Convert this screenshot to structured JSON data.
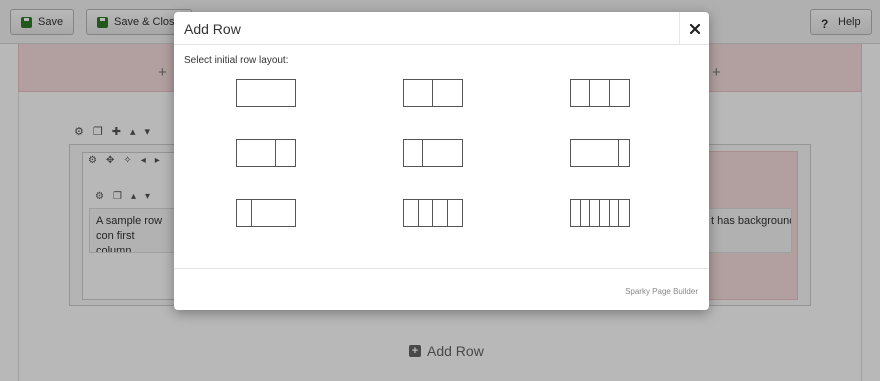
{
  "toolbar": {
    "save_label": "Save",
    "save_close_label": "Save & Close",
    "help_label": "Help"
  },
  "builder": {
    "sample_text_left": "A sample row con first column.",
    "sample_text_right": "t has background",
    "add_row_label": "Add Row"
  },
  "modal": {
    "title": "Add Row",
    "instruction": "Select initial row layout:",
    "footer_brand": "Sparky Page Builder",
    "layouts": [
      {
        "name": "1 column",
        "columns": [
          12
        ]
      },
      {
        "name": "2 columns",
        "columns": [
          6,
          6
        ]
      },
      {
        "name": "3 columns",
        "columns": [
          4,
          4,
          4
        ]
      },
      {
        "name": "2 columns wide left",
        "columns": [
          8,
          4
        ]
      },
      {
        "name": "2 columns wide right",
        "columns": [
          4,
          8
        ]
      },
      {
        "name": "2 columns narrow right",
        "columns": [
          10,
          2
        ]
      },
      {
        "name": "2 columns narrow left",
        "columns": [
          3,
          9
        ]
      },
      {
        "name": "4 columns",
        "columns": [
          3,
          3,
          3,
          3
        ]
      },
      {
        "name": "6 columns",
        "columns": [
          2,
          2,
          2,
          2,
          2,
          2
        ]
      }
    ]
  },
  "colors": {
    "overlay": "rgba(0,0,0,0.28)",
    "save_icon": "#2f7a28",
    "pink_background": "#f7dede"
  }
}
